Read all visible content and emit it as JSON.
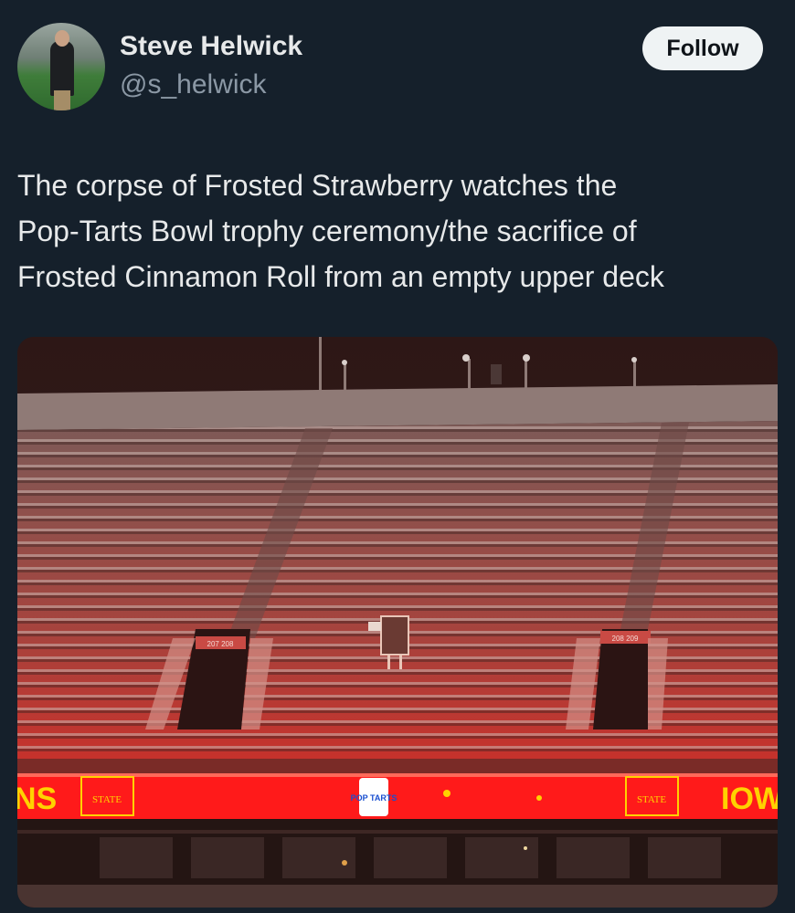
{
  "user": {
    "name": "Steve Helwick",
    "handle": "@s_helwick"
  },
  "follow_label": "Follow",
  "tweet": {
    "text": "The corpse of Frosted Strawberry watches the\nPop-Tarts Bowl trophy ceremony/the sacrifice of\nFrosted Cinnamon Roll from an empty upper deck"
  },
  "photo": {
    "section_sign_left": "207 208",
    "section_sign_right": "208 209",
    "banner_text_left": "NS",
    "banner_logo_text": "STATE",
    "banner_text_right": "IOW",
    "popup_logo": "POP TARTS"
  },
  "colors": {
    "background": "#15202b",
    "follow_bg": "#eff3f4",
    "handle": "#8b98a5",
    "banner_red": "#ff1a1a",
    "banner_yellow": "#ffd200"
  }
}
